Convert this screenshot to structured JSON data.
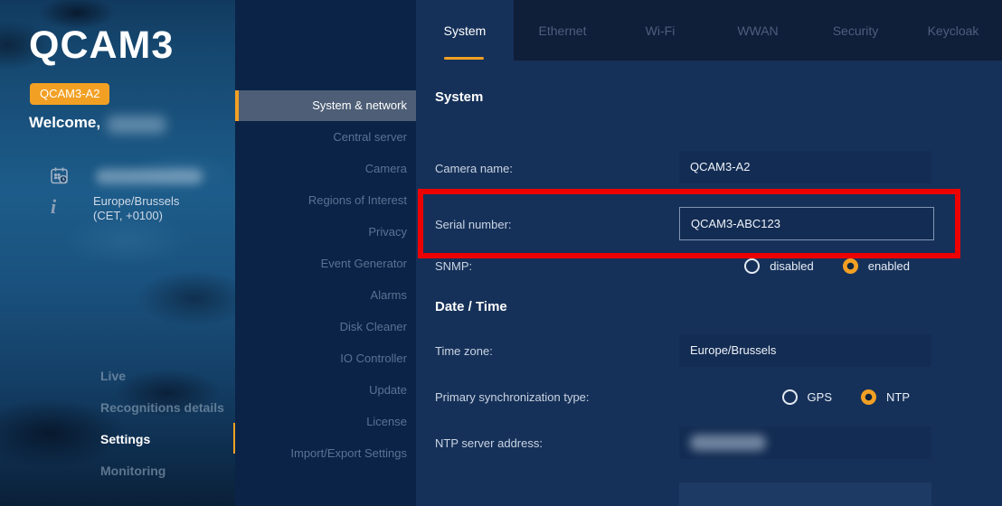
{
  "colors": {
    "accent_orange": "#F2A024",
    "annotation_red": "#EC0000",
    "selected_menu_bg": "#4D5E76"
  },
  "sidebar": {
    "brand": "QCAM3",
    "device_badge": "QCAM3-A2",
    "welcome_label": "Welcome,",
    "icons": {
      "datetime": "calendar-clock-icon",
      "info": "info-icon"
    },
    "timezone": {
      "line1": "Europe/Brussels",
      "line2": "(CET, +0100)"
    },
    "nav": {
      "items": [
        {
          "label": "Live",
          "active": false
        },
        {
          "label": "Recognitions details",
          "active": false
        },
        {
          "label": "Settings",
          "active": true
        },
        {
          "label": "Monitoring",
          "active": false
        }
      ]
    }
  },
  "settings_menu": {
    "items": [
      {
        "label": "System & network",
        "selected": true
      },
      {
        "label": "Central server",
        "selected": false
      },
      {
        "label": "Camera",
        "selected": false
      },
      {
        "label": "Regions of Interest",
        "selected": false
      },
      {
        "label": "Privacy",
        "selected": false
      },
      {
        "label": "Event Generator",
        "selected": false
      },
      {
        "label": "Alarms",
        "selected": false
      },
      {
        "label": "Disk Cleaner",
        "selected": false
      },
      {
        "label": "IO Controller",
        "selected": false
      },
      {
        "label": "Update",
        "selected": false
      },
      {
        "label": "License",
        "selected": false
      },
      {
        "label": "Import/Export Settings",
        "selected": false
      }
    ]
  },
  "tabs": {
    "items": [
      {
        "label": "System",
        "active": true
      },
      {
        "label": "Ethernet",
        "active": false
      },
      {
        "label": "Wi-Fi",
        "active": false
      },
      {
        "label": "WWAN",
        "active": false
      },
      {
        "label": "Security",
        "active": false
      },
      {
        "label": "Keycloak",
        "active": false
      }
    ]
  },
  "content": {
    "system_heading": "System",
    "camera_name": {
      "label": "Camera name:",
      "value": "QCAM3-A2"
    },
    "serial_number": {
      "label": "Serial number:",
      "value": "QCAM3-ABC123",
      "highlighted": true
    },
    "snmp": {
      "label": "SNMP:",
      "options": [
        {
          "label": "disabled",
          "selected": false
        },
        {
          "label": "enabled",
          "selected": true
        }
      ]
    },
    "datetime_heading": "Date / Time",
    "time_zone": {
      "label": "Time zone:",
      "value": "Europe/Brussels"
    },
    "primary_sync": {
      "label": "Primary synchronization type:",
      "options": [
        {
          "label": "GPS",
          "selected": false
        },
        {
          "label": "NTP",
          "selected": true
        }
      ]
    },
    "ntp_server": {
      "label": "NTP server address:"
    }
  }
}
